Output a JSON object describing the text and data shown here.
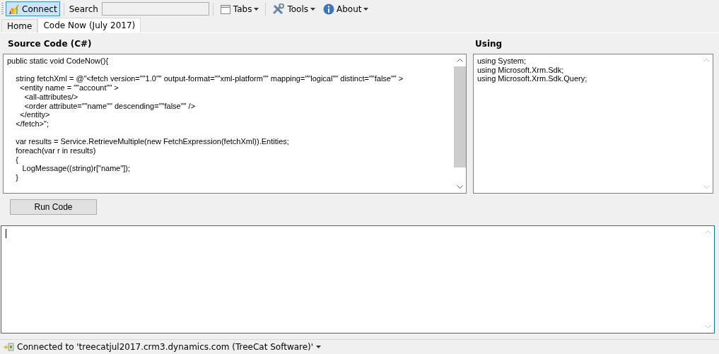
{
  "toolbar": {
    "items": [
      {
        "kind": "button",
        "label": "Connect",
        "selected": true
      },
      {
        "kind": "separator"
      },
      {
        "kind": "label",
        "label": "Search"
      },
      {
        "kind": "field",
        "value": ""
      },
      {
        "kind": "separator"
      },
      {
        "kind": "menu",
        "label": "Tabs"
      },
      {
        "kind": "separator"
      },
      {
        "kind": "menu",
        "label": "Tools"
      },
      {
        "kind": "menu",
        "label": "About"
      }
    ]
  },
  "tabs": [
    {
      "label": "Home",
      "selected": false
    },
    {
      "label": "Code Now (July 2017)",
      "selected": true
    }
  ],
  "source": {
    "title": "Source Code (C#)",
    "code": "public static void CodeNow(){\n\n    string fetchXml = @\"<fetch version=\"\"1.0\"\" output-format=\"\"xml-platform\"\" mapping=\"\"logical\"\" distinct=\"\"false\"\" >\n      <entity name = \"\"account\"\" >\n        <all-attributes/>\n        <order attribute=\"\"name\"\" descending=\"\"false\"\" />\n      </entity>\n    </fetch>\";\n\n    var results = Service.RetrieveMultiple(new FetchExpression(fetchXml)).Entities;\n    foreach(var r in results)\n    {\n       LogMessage((string)r[\"name\"]);\n    }"
  },
  "using": {
    "title": "Using",
    "code": "using System;\nusing Microsoft.Xrm.Sdk;\nusing Microsoft.Xrm.Sdk.Query;"
  },
  "run_button": {
    "label": "Run Code"
  },
  "output": {
    "focused": true
  },
  "status_bar": {
    "text": "Connected to 'treecatjul2017.crm3.dynamics.com (TreeCat Software)'"
  }
}
